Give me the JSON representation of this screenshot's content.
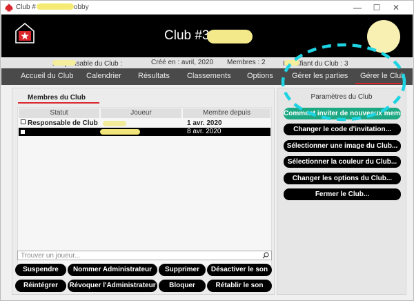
{
  "window": {
    "title_start": "Club #",
    "title_end": "obby",
    "controls": {
      "minimize": "—",
      "maximize": "☐",
      "close": "✕"
    }
  },
  "header": {
    "club_title": "Club #3",
    "avatar": "user-avatar"
  },
  "info": {
    "owner_label": "Responsable du Club :",
    "created": "Créé en : avril, 2020",
    "members": "Membres : 2",
    "club_id_label": "Identifiant du Club : 3"
  },
  "nav": {
    "items": [
      "Accueil du Club",
      "Calendrier",
      "Résultats",
      "Classements",
      "Options",
      "Gérer les parties",
      "Gérer le Club"
    ],
    "active_index": 6
  },
  "members": {
    "tab_label": "Membres du Club",
    "columns": [
      "Statut",
      "Joueur",
      "Membre depuis"
    ],
    "rows": [
      {
        "status": "Responsable de Club",
        "since": "1 avr. 2020",
        "selected": false
      },
      {
        "status": "",
        "since": "8 avr. 2020",
        "selected": true
      }
    ],
    "search_placeholder": "Trouver un joueur..."
  },
  "actions": {
    "row1": [
      "Suspendre",
      "Nommer Administrateur",
      "Supprimer",
      "Désactiver le son"
    ],
    "row2": [
      "Réintégrer",
      "Révoquer l'Administrateur",
      "Bloquer",
      "Rétablir le son"
    ]
  },
  "settings": {
    "title": "Paramètres du Club",
    "buttons": [
      "Comment inviter de nouveaux membres...",
      "Changer le code d'invitation...",
      "Sélectionner une image du Club...",
      "Sélectionner la couleur du Club...",
      "Changer les options du Club...",
      "Fermer le Club..."
    ]
  },
  "colors": {
    "accent_red": "#d9262c",
    "teal_button": "#1da883",
    "annotation": "#1ed3e2"
  }
}
